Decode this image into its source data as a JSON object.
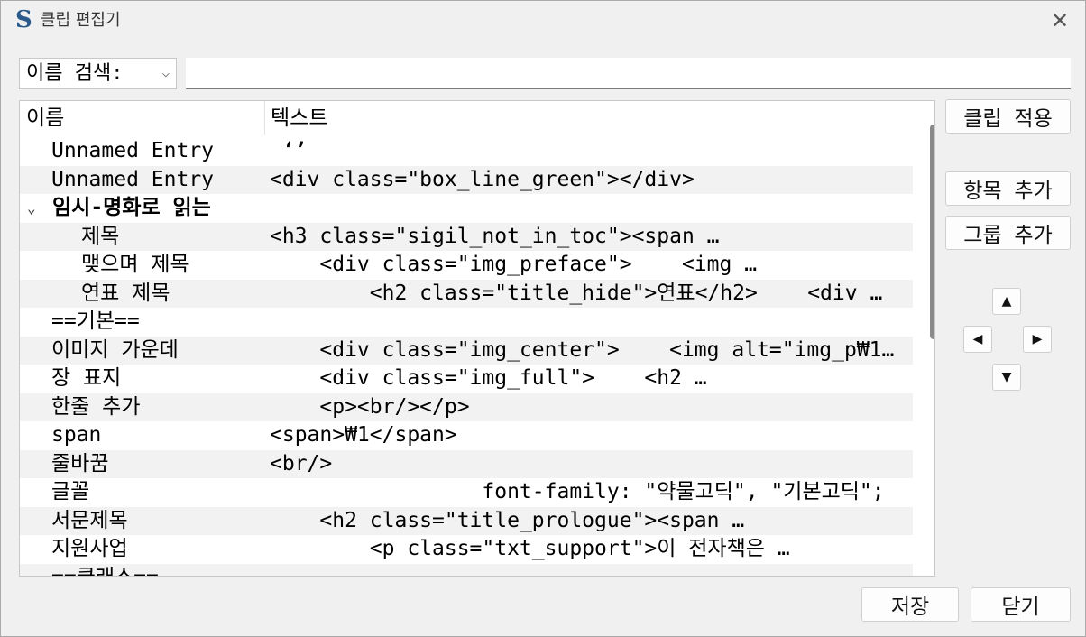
{
  "window": {
    "title": "클립 편집기",
    "app_icon_glyph": "S",
    "close_glyph": "✕"
  },
  "search": {
    "mode_label": "이름 검색:",
    "value": "",
    "placeholder": ""
  },
  "tree": {
    "columns": {
      "name": "이름",
      "text": "텍스트"
    },
    "rows": [
      {
        "name": "Unnamed Entry",
        "text": " ‘’",
        "level": 1
      },
      {
        "name": "Unnamed Entry",
        "text": "<div class=\"box_line_green\"></div>",
        "level": 1
      },
      {
        "name": "임시-명화로 읽는",
        "text": "",
        "level": 0,
        "group": true,
        "expanded": true,
        "expander": "⌄"
      },
      {
        "name": "제목",
        "text": "<h3 class=\"sigil_not_in_toc\"><span …",
        "level": 2
      },
      {
        "name": "맺으며 제목",
        "text": "    <div class=\"img_preface\">    <img …",
        "level": 2
      },
      {
        "name": "연표 제목",
        "text": "        <h2 class=\"title_hide\">연표</h2>    <div …",
        "level": 2
      },
      {
        "name": "==기본==",
        "text": "",
        "level": 1
      },
      {
        "name": "이미지 가운데",
        "text": "    <div class=\"img_center\">    <img alt=\"img_p₩1…",
        "level": 1
      },
      {
        "name": "장 표지",
        "text": "    <div class=\"img_full\">    <h2 …",
        "level": 1
      },
      {
        "name": "한줄 추가",
        "text": "    <p><br/></p>",
        "level": 1
      },
      {
        "name": "span",
        "text": "<span>₩1</span>",
        "level": 1
      },
      {
        "name": "줄바꿈",
        "text": "<br/>",
        "level": 1
      },
      {
        "name": "글꼴",
        "text": "                 font-family: \"약물고딕\", \"기본고딕\";",
        "level": 1
      },
      {
        "name": "서문제목",
        "text": "    <h2 class=\"title_prologue\"><span …",
        "level": 1
      },
      {
        "name": "지원사업",
        "text": "        <p class=\"txt_support\">이 전자책은 …",
        "level": 1
      },
      {
        "name": "==클래스==",
        "text": "",
        "level": 1
      }
    ]
  },
  "buttons": {
    "apply": "클립 적용",
    "add_item": "항목 추가",
    "add_group": "그룹 추가",
    "save": "저장",
    "close": "닫기"
  },
  "icons": {
    "arrow_up": "▲",
    "arrow_left": "◀",
    "arrow_right": "▶",
    "arrow_down": "▼"
  }
}
